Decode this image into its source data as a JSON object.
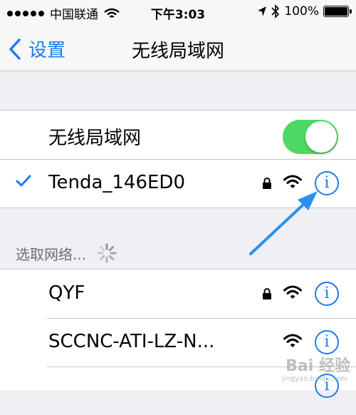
{
  "status_bar": {
    "carrier": "中国联通",
    "time": "下午3:03",
    "battery": "100%",
    "icons": [
      "signal-dots-icon",
      "wifi-icon",
      "location-arrow-icon",
      "bluetooth-icon",
      "battery-icon"
    ]
  },
  "nav": {
    "back_label": "设置",
    "title": "无线局域网"
  },
  "wifi_toggle": {
    "label": "无线局域网",
    "on": true
  },
  "connected": {
    "name": "Tenda_146ED0",
    "secured": true
  },
  "section": {
    "header": "选取网络..."
  },
  "networks": [
    {
      "name": "QYF",
      "secured": true
    },
    {
      "name": "SCCNC-ATI-LZ-N...",
      "secured": false
    }
  ],
  "watermark": {
    "text": "Bai 经验",
    "sub": "jingyan.baidu.com"
  },
  "colors": {
    "accent": "#1a7cf2",
    "toggle_on": "#4cd964",
    "background": "#efeff4",
    "separator": "#c8c7cc",
    "section_text": "#6d6d72"
  }
}
